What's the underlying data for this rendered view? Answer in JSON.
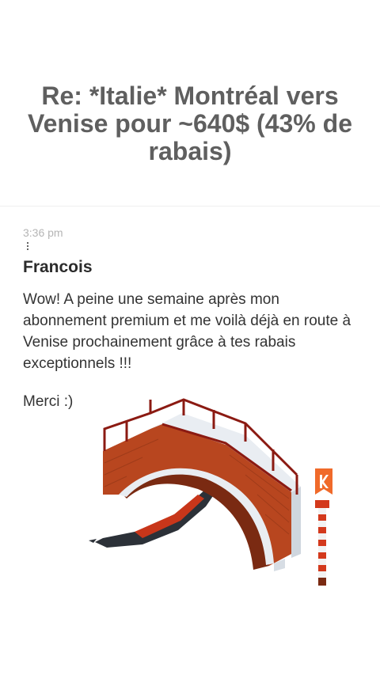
{
  "post": {
    "title": "Re: *Italie* Montréal vers Venise pour ~640$ (43% de rabais)"
  },
  "message": {
    "time": "3:36 pm",
    "author": "Francois",
    "body": "Wow! A peine une semaine après mon abonnement premium et me voilà déjà en route à Venise prochainement grâce à tes rabais exceptionnels !!!",
    "signoff": "Merci :)"
  },
  "illustration": {
    "subject": "venice-bridge-gondola",
    "flag_icon": "k-flag-icon",
    "colors": {
      "brick": "#b8461f",
      "stone": "#e9edf2",
      "gondola": "#2c3138",
      "pole_red": "#d3391c",
      "flag": "#f06a2a"
    }
  }
}
